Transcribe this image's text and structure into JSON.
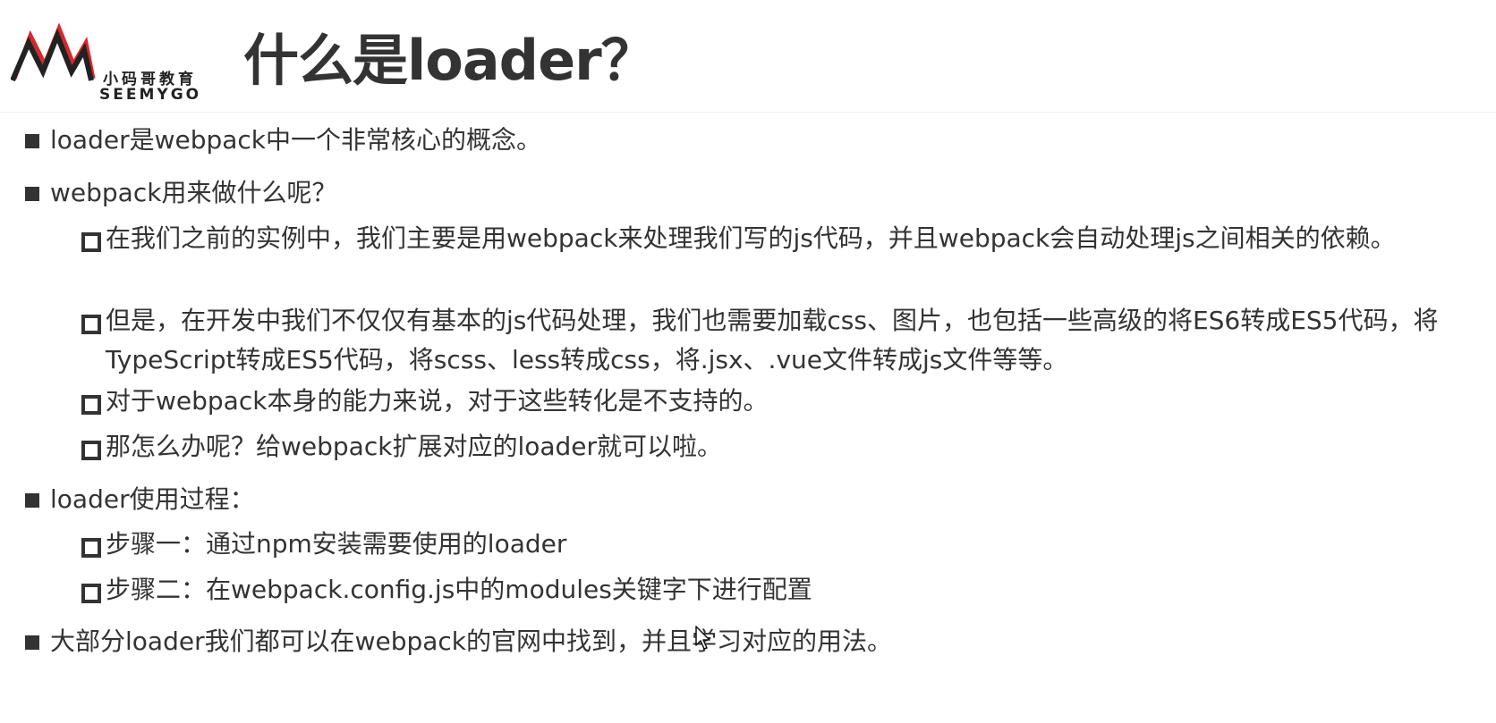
{
  "header": {
    "logo_cn": "小码哥教育",
    "logo_en": "SEEMYGO",
    "title": "什么是loader？"
  },
  "bullets": [
    {
      "level": 1,
      "text": "loader是webpack中一个非常核心的概念。"
    },
    {
      "level": 1,
      "text": "webpack用来做什么呢？"
    },
    {
      "level": 2,
      "text": "在我们之前的实例中，我们主要是用webpack来处理我们写的js代码，并且webpack会自动处理js之间相关的依赖。"
    },
    {
      "level": 2,
      "text": "但是，在开发中我们不仅仅有基本的js代码处理，我们也需要加载css、图片，也包括一些高级的将ES6转成ES5代码，将TypeScript转成ES5代码，将scss、less转成css，将.jsx、.vue文件转成js文件等等。"
    },
    {
      "level": 2,
      "text": "对于webpack本身的能力来说，对于这些转化是不支持的。"
    },
    {
      "level": 2,
      "text": "那怎么办呢？给webpack扩展对应的loader就可以啦。"
    },
    {
      "level": 1,
      "text": "loader使用过程："
    },
    {
      "level": 2,
      "text": "步骤一：通过npm安装需要使用的loader"
    },
    {
      "level": 2,
      "text": "步骤二：在webpack.config.js中的modules关键字下进行配置"
    },
    {
      "level": 1,
      "text": "大部分loader我们都可以在webpack的官网中找到，并且学习对应的用法。"
    }
  ],
  "colors": {
    "text": "#333333",
    "logo_red": "#d9262c",
    "logo_black": "#222222",
    "background": "#ffffff"
  }
}
